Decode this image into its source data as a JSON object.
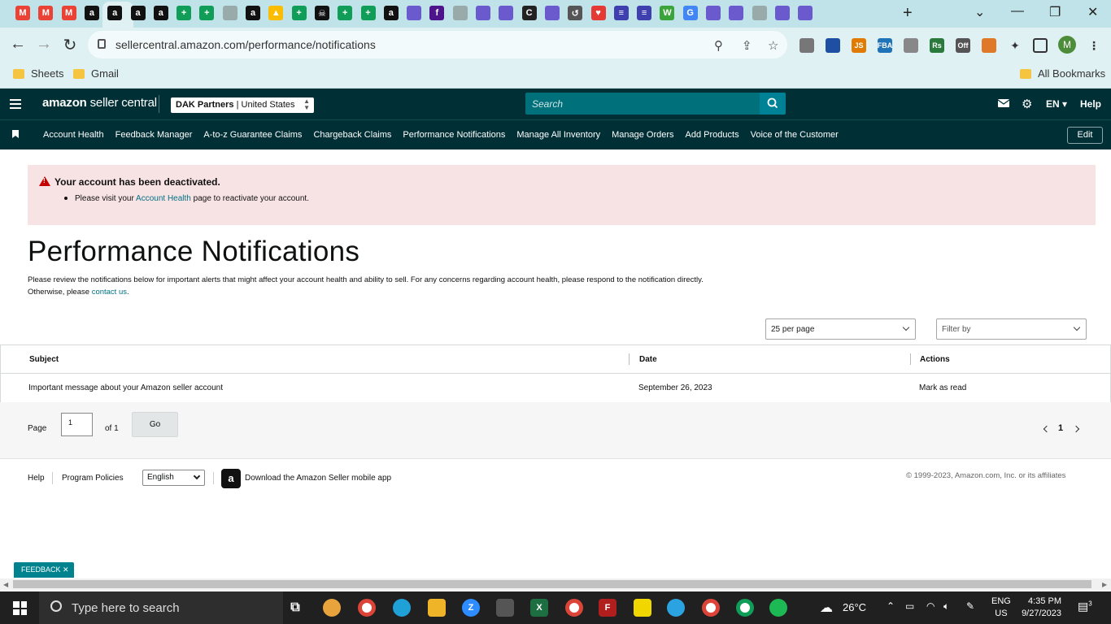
{
  "browser": {
    "url": "sellercentral.amazon.com/performance/notifications",
    "bookmarks": [
      "Sheets",
      "Gmail"
    ],
    "all_bookmarks": "All Bookmarks",
    "profile_initial": "M",
    "tab_favicons": [
      "gmail",
      "gmail",
      "gmail",
      "amazon",
      "amazon",
      "amazon",
      "amazon",
      "sheets",
      "sheets",
      "globe",
      "amazon",
      "drive",
      "sheets",
      "pirate",
      "sheets",
      "sheets",
      "amazon",
      "app",
      "fedex",
      "globe",
      "app",
      "app",
      "c-app",
      "app",
      "history",
      "heart",
      "list",
      "list",
      "w-app",
      "google",
      "app",
      "app",
      "globe",
      "app",
      "app"
    ],
    "extensions": [
      "ext",
      "ext",
      "JS",
      "FBA",
      "ext",
      "Rs",
      "Off",
      "ext"
    ]
  },
  "header": {
    "logo_brand": "amazon",
    "logo_product": "seller central",
    "account_name": "DAK Partners",
    "account_region": "United States",
    "search_placeholder": "Search",
    "language": "EN",
    "help": "Help"
  },
  "nav": {
    "items": [
      "Account Health",
      "Feedback Manager",
      "A-to-z Guarantee Claims",
      "Chargeback Claims",
      "Performance Notifications",
      "Manage All Inventory",
      "Manage Orders",
      "Add Products",
      "Voice of the Customer"
    ],
    "edit": "Edit"
  },
  "alert": {
    "title": "Your account has been deactivated.",
    "body_prefix": "Please visit your",
    "body_link": "Account Health",
    "body_suffix": "page to reactivate your account."
  },
  "page": {
    "title": "Performance Notifications",
    "desc_main": "Please review the notifications below for important alerts that might affect your account health and ability to sell. For any concerns regarding account health, please respond to the notification directly. Otherwise, please",
    "desc_link": "contact us",
    "desc_end": "."
  },
  "filters": {
    "per_page": "25 per page",
    "filter_by": "Filter by"
  },
  "table": {
    "headers": [
      "Subject",
      "Date",
      "Actions"
    ],
    "rows": [
      {
        "subject": "Important message about your Amazon seller account",
        "date": "September 26, 2023",
        "action": "Mark as read"
      }
    ]
  },
  "pager": {
    "page_label": "Page",
    "current_page": "1",
    "of_label": "of 1",
    "go": "Go",
    "page_number": "1"
  },
  "footer": {
    "help": "Help",
    "policies": "Program Policies",
    "language": "English",
    "app_text": "Download the Amazon Seller mobile app",
    "copyright": "© 1999-2023, Amazon.com, Inc. or its affiliates"
  },
  "feedback": "FEEDBACK",
  "taskbar": {
    "search": "Type here to search",
    "weather": "26°C",
    "lang": "ENG",
    "region": "US",
    "time": "4:35 PM",
    "date": "9/27/2023",
    "notifications": "3"
  }
}
